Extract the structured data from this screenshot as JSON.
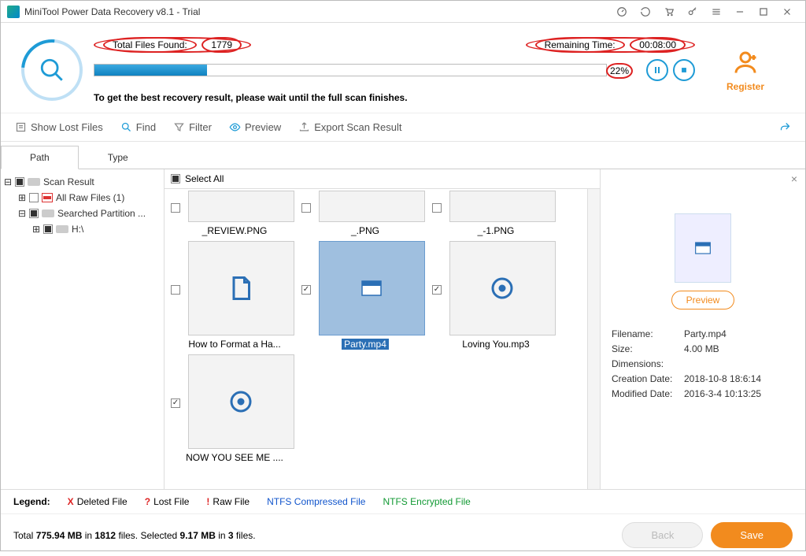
{
  "title": "MiniTool Power Data Recovery v8.1 - Trial",
  "progress": {
    "found_label": "Total Files Found:",
    "found_value": "1779",
    "remaining_label": "Remaining Time:",
    "remaining_value": "00:08:00",
    "percent": "22%",
    "note": "To get the best recovery result, please wait until the full scan finishes."
  },
  "register": "Register",
  "toolbar": {
    "show_lost": "Show Lost Files",
    "find": "Find",
    "filter": "Filter",
    "preview": "Preview",
    "export": "Export Scan Result"
  },
  "tabs": {
    "path": "Path",
    "type": "Type"
  },
  "tree": {
    "root": "Scan Result",
    "raw": "All Raw Files (1)",
    "searched": "Searched Partition ...",
    "drive": "H:\\"
  },
  "select_all": "Select All",
  "files": {
    "f0": "_REVIEW.PNG",
    "f1": "_.PNG",
    "f2": "_-1.PNG",
    "f3": "How to Format a Ha...",
    "f4": "Party.mp4",
    "f5": "Loving You.mp3",
    "f6": "NOW YOU SEE ME ...."
  },
  "preview": {
    "btn": "Preview",
    "filename_k": "Filename:",
    "filename_v": "Party.mp4",
    "size_k": "Size:",
    "size_v": "4.00 MB",
    "dim_k": "Dimensions:",
    "dim_v": "",
    "created_k": "Creation Date:",
    "created_v": "2018-10-8 18:6:14",
    "modified_k": "Modified Date:",
    "modified_v": "2016-3-4 10:13:25"
  },
  "legend": {
    "label": "Legend:",
    "deleted": "Deleted File",
    "lost": "Lost File",
    "raw": "Raw File",
    "ntfs_c": "NTFS Compressed File",
    "ntfs_e": "NTFS Encrypted File"
  },
  "footer": {
    "total_a": "Total ",
    "total_mb": "775.94 MB",
    "in": " in ",
    "total_files": "1812",
    "files": " files.",
    "sel": "  Selected ",
    "sel_mb": "9.17 MB",
    "sel_files": "3",
    "back": "Back",
    "save": "Save"
  }
}
